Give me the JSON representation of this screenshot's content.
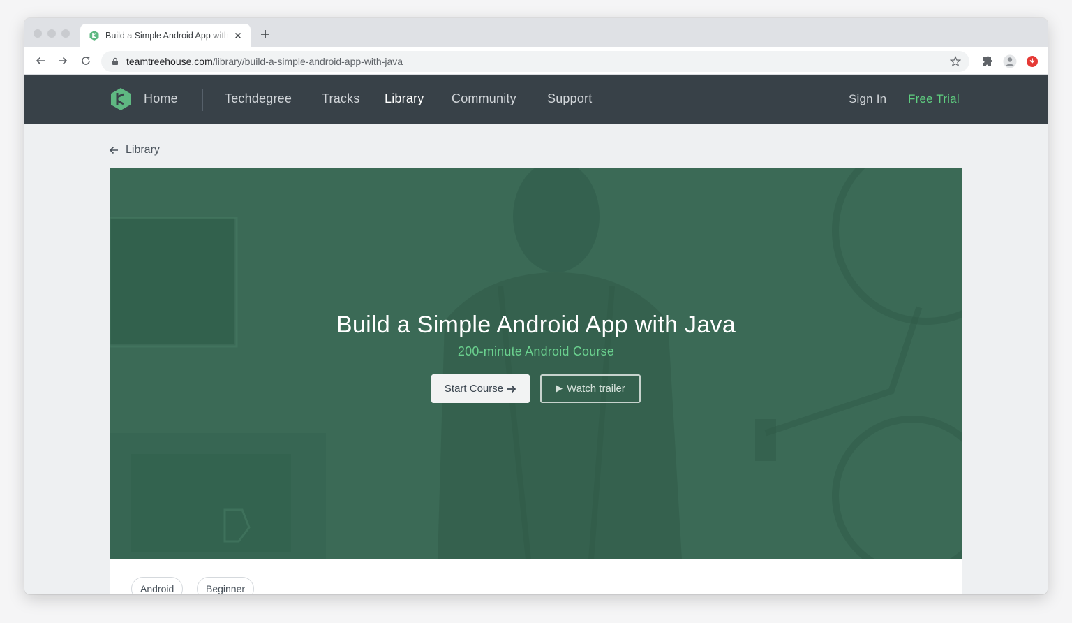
{
  "browser": {
    "tab_title": "Build a Simple Android App with Java",
    "url_host": "teamtreehouse.com",
    "url_path": "/library/build-a-simple-android-app-with-java",
    "icons": [
      "back-icon",
      "forward-icon",
      "reload-icon",
      "lock-icon",
      "star-icon",
      "extensions-icon",
      "profile-avatar",
      "extension-badge-icon"
    ]
  },
  "nav": {
    "home": "Home",
    "items": [
      "Techdegree",
      "Tracks",
      "Library",
      "Community",
      "Support"
    ],
    "active": "Library",
    "sign_in": "Sign In",
    "free_trial": "Free Trial"
  },
  "breadcrumb": {
    "back_label": "Library"
  },
  "hero": {
    "title": "Build a Simple Android App with Java",
    "subtitle": "200-minute Android Course",
    "start_label": "Start Course",
    "trailer_label": "Watch trailer"
  },
  "tags": [
    "Android",
    "Beginner"
  ],
  "colors": {
    "nav_bg": "#384148",
    "accent_green": "#5fcf80",
    "hero_overlay": "#3a6a55"
  }
}
